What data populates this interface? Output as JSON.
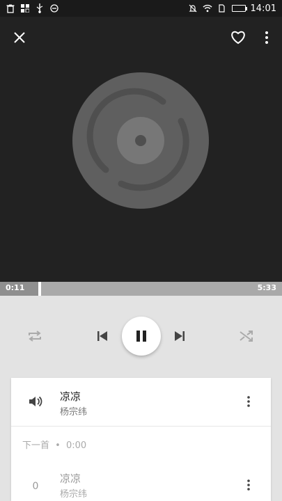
{
  "status_bar": {
    "time": "14:01",
    "left_icons": [
      "trash-icon",
      "gallery-icon",
      "usb-icon",
      "minus-circle-icon"
    ],
    "right_icons": [
      "mute-icon",
      "wifi-icon",
      "sim-icon",
      "battery-icon"
    ]
  },
  "header": {
    "close_icon": "close-icon",
    "favorite_icon": "heart-icon",
    "menu_icon": "more-vert-icon"
  },
  "player": {
    "elapsed": "0:11",
    "duration": "5:33",
    "progress_fraction": 0.033,
    "state": "playing"
  },
  "controls": [
    "repeat-icon",
    "previous-icon",
    "pause-icon",
    "next-icon",
    "shuffle-icon"
  ],
  "now_playing": {
    "title": "凉凉",
    "artist": "杨宗纬",
    "indicator": "speaker-icon"
  },
  "up_next": {
    "label": "下一首",
    "separator": "•",
    "duration": "0:00",
    "items": [
      {
        "index": "0",
        "title": "凉凉",
        "artist": "杨宗纬"
      }
    ]
  },
  "colors": {
    "artwork_bg": "#222222",
    "disc": "#5f5f5f",
    "progress_bg": "#a9a9a9",
    "accent_battery": "#4cd964"
  }
}
